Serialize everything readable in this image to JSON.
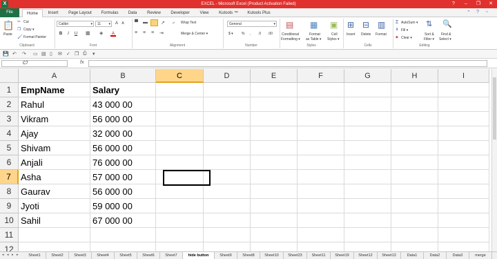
{
  "window": {
    "title": "EXCEL - Microsoft Excel (Product Activation Failed)",
    "app_icon": "X",
    "controls": [
      "?",
      "–",
      "❐",
      "✕"
    ]
  },
  "tabs": [
    "File",
    "Home",
    "Insert",
    "Page Layout",
    "Formulas",
    "Data",
    "Review",
    "Developer",
    "View",
    "Kutools ™",
    "Kutools Plus"
  ],
  "active_tab": "Home",
  "ribbon": {
    "clipboard": {
      "paste": "Paste",
      "cut": "Cut",
      "copy": "Copy ▾",
      "format_painter": "Format Painter",
      "label": "Clipboard"
    },
    "font": {
      "name": "Calibri",
      "size": "11",
      "label": "Font",
      "bold": "B",
      "italic": "I",
      "underline": "U",
      "grow": "A",
      "shrink": "A",
      "fill": "A",
      "color": "A"
    },
    "alignment": {
      "wrap_text": "Wrap Text",
      "merge_center": "Merge & Center ▾",
      "label": "Alignment"
    },
    "number": {
      "format": "General",
      "currency": "$ ▾",
      "percent": "%",
      "comma": ",",
      "inc_dec": ".0",
      "dec_dec": ".00",
      "label": "Number"
    },
    "styles": {
      "conditional": "Conditional",
      "conditional2": "Formatting ▾",
      "format_table": "Format",
      "format_table2": "as Table ▾",
      "cell_styles": "Cell",
      "cell_styles2": "Styles ▾",
      "label": "Styles"
    },
    "cells": {
      "insert": "Insert",
      "delete": "Delete",
      "format": "Format",
      "label": "Cells"
    },
    "editing": {
      "autosum": "AutoSum ▾",
      "fill": "Fill ▾",
      "clear": "Clear ▾",
      "sort": "Sort &",
      "sort2": "Filter ▾",
      "find": "Find &",
      "find2": "Select ▾",
      "label": "Editing"
    }
  },
  "formula_bar": {
    "name_box": "C7",
    "fx": "fx",
    "value": ""
  },
  "columns": [
    "A",
    "B",
    "C",
    "D",
    "E",
    "F",
    "G",
    "H",
    "I"
  ],
  "selected_column": "C",
  "rows": [
    {
      "n": "1",
      "a": "EmpName",
      "b": "Salary"
    },
    {
      "n": "2",
      "a": "Rahul",
      "b": "43 000 00"
    },
    {
      "n": "3",
      "a": "Vikram",
      "b": "56 000 00"
    },
    {
      "n": "4",
      "a": "Ajay",
      "b": "32 000 00"
    },
    {
      "n": "5",
      "a": "Shivam",
      "b": "56 000 00"
    },
    {
      "n": "6",
      "a": "Anjali",
      "b": "76 000 00"
    },
    {
      "n": "7",
      "a": "Asha",
      "b": "57 000 00"
    },
    {
      "n": "8",
      "a": "Gaurav",
      "b": "56 000 00"
    },
    {
      "n": "9",
      "a": "Jyoti",
      "b": "59 000 00"
    },
    {
      "n": "10",
      "a": "Sahil",
      "b": "67 000 00"
    },
    {
      "n": "11",
      "a": "",
      "b": ""
    },
    {
      "n": "12",
      "a": "",
      "b": ""
    }
  ],
  "selected_row": "7",
  "sheets": [
    "Sheet1",
    "Sheet2",
    "Sheet3",
    "Sheet4",
    "Sheet5",
    "Sheet6",
    "Sheet7",
    "hide button",
    "Sheet9",
    "Sheet8",
    "Sheet10",
    "Sheet23",
    "Sheet11",
    "Sheet19",
    "Sheet12",
    "Sheet13",
    "Data1",
    "Data2",
    "Data3",
    "merge"
  ],
  "active_sheet": "hide button",
  "colors": {
    "excel_green": "#1e7145",
    "title_red": "#e0312e",
    "selection_header": "#ffd58a"
  }
}
